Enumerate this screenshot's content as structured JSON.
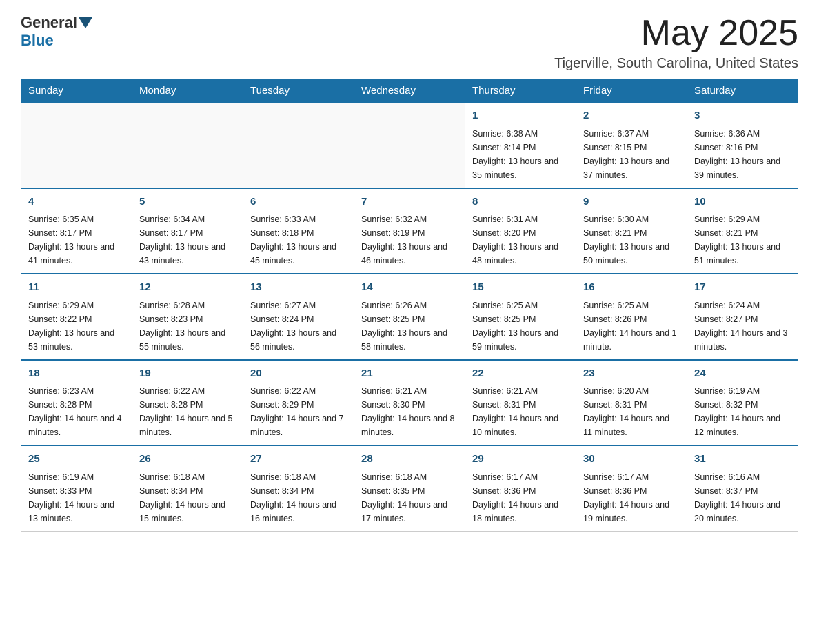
{
  "logo": {
    "general": "General",
    "blue": "Blue"
  },
  "title": {
    "month": "May 2025",
    "location": "Tigerville, South Carolina, United States"
  },
  "weekdays": [
    "Sunday",
    "Monday",
    "Tuesday",
    "Wednesday",
    "Thursday",
    "Friday",
    "Saturday"
  ],
  "weeks": [
    [
      {
        "day": "",
        "info": ""
      },
      {
        "day": "",
        "info": ""
      },
      {
        "day": "",
        "info": ""
      },
      {
        "day": "",
        "info": ""
      },
      {
        "day": "1",
        "info": "Sunrise: 6:38 AM\nSunset: 8:14 PM\nDaylight: 13 hours and 35 minutes."
      },
      {
        "day": "2",
        "info": "Sunrise: 6:37 AM\nSunset: 8:15 PM\nDaylight: 13 hours and 37 minutes."
      },
      {
        "day": "3",
        "info": "Sunrise: 6:36 AM\nSunset: 8:16 PM\nDaylight: 13 hours and 39 minutes."
      }
    ],
    [
      {
        "day": "4",
        "info": "Sunrise: 6:35 AM\nSunset: 8:17 PM\nDaylight: 13 hours and 41 minutes."
      },
      {
        "day": "5",
        "info": "Sunrise: 6:34 AM\nSunset: 8:17 PM\nDaylight: 13 hours and 43 minutes."
      },
      {
        "day": "6",
        "info": "Sunrise: 6:33 AM\nSunset: 8:18 PM\nDaylight: 13 hours and 45 minutes."
      },
      {
        "day": "7",
        "info": "Sunrise: 6:32 AM\nSunset: 8:19 PM\nDaylight: 13 hours and 46 minutes."
      },
      {
        "day": "8",
        "info": "Sunrise: 6:31 AM\nSunset: 8:20 PM\nDaylight: 13 hours and 48 minutes."
      },
      {
        "day": "9",
        "info": "Sunrise: 6:30 AM\nSunset: 8:21 PM\nDaylight: 13 hours and 50 minutes."
      },
      {
        "day": "10",
        "info": "Sunrise: 6:29 AM\nSunset: 8:21 PM\nDaylight: 13 hours and 51 minutes."
      }
    ],
    [
      {
        "day": "11",
        "info": "Sunrise: 6:29 AM\nSunset: 8:22 PM\nDaylight: 13 hours and 53 minutes."
      },
      {
        "day": "12",
        "info": "Sunrise: 6:28 AM\nSunset: 8:23 PM\nDaylight: 13 hours and 55 minutes."
      },
      {
        "day": "13",
        "info": "Sunrise: 6:27 AM\nSunset: 8:24 PM\nDaylight: 13 hours and 56 minutes."
      },
      {
        "day": "14",
        "info": "Sunrise: 6:26 AM\nSunset: 8:25 PM\nDaylight: 13 hours and 58 minutes."
      },
      {
        "day": "15",
        "info": "Sunrise: 6:25 AM\nSunset: 8:25 PM\nDaylight: 13 hours and 59 minutes."
      },
      {
        "day": "16",
        "info": "Sunrise: 6:25 AM\nSunset: 8:26 PM\nDaylight: 14 hours and 1 minute."
      },
      {
        "day": "17",
        "info": "Sunrise: 6:24 AM\nSunset: 8:27 PM\nDaylight: 14 hours and 3 minutes."
      }
    ],
    [
      {
        "day": "18",
        "info": "Sunrise: 6:23 AM\nSunset: 8:28 PM\nDaylight: 14 hours and 4 minutes."
      },
      {
        "day": "19",
        "info": "Sunrise: 6:22 AM\nSunset: 8:28 PM\nDaylight: 14 hours and 5 minutes."
      },
      {
        "day": "20",
        "info": "Sunrise: 6:22 AM\nSunset: 8:29 PM\nDaylight: 14 hours and 7 minutes."
      },
      {
        "day": "21",
        "info": "Sunrise: 6:21 AM\nSunset: 8:30 PM\nDaylight: 14 hours and 8 minutes."
      },
      {
        "day": "22",
        "info": "Sunrise: 6:21 AM\nSunset: 8:31 PM\nDaylight: 14 hours and 10 minutes."
      },
      {
        "day": "23",
        "info": "Sunrise: 6:20 AM\nSunset: 8:31 PM\nDaylight: 14 hours and 11 minutes."
      },
      {
        "day": "24",
        "info": "Sunrise: 6:19 AM\nSunset: 8:32 PM\nDaylight: 14 hours and 12 minutes."
      }
    ],
    [
      {
        "day": "25",
        "info": "Sunrise: 6:19 AM\nSunset: 8:33 PM\nDaylight: 14 hours and 13 minutes."
      },
      {
        "day": "26",
        "info": "Sunrise: 6:18 AM\nSunset: 8:34 PM\nDaylight: 14 hours and 15 minutes."
      },
      {
        "day": "27",
        "info": "Sunrise: 6:18 AM\nSunset: 8:34 PM\nDaylight: 14 hours and 16 minutes."
      },
      {
        "day": "28",
        "info": "Sunrise: 6:18 AM\nSunset: 8:35 PM\nDaylight: 14 hours and 17 minutes."
      },
      {
        "day": "29",
        "info": "Sunrise: 6:17 AM\nSunset: 8:36 PM\nDaylight: 14 hours and 18 minutes."
      },
      {
        "day": "30",
        "info": "Sunrise: 6:17 AM\nSunset: 8:36 PM\nDaylight: 14 hours and 19 minutes."
      },
      {
        "day": "31",
        "info": "Sunrise: 6:16 AM\nSunset: 8:37 PM\nDaylight: 14 hours and 20 minutes."
      }
    ]
  ]
}
